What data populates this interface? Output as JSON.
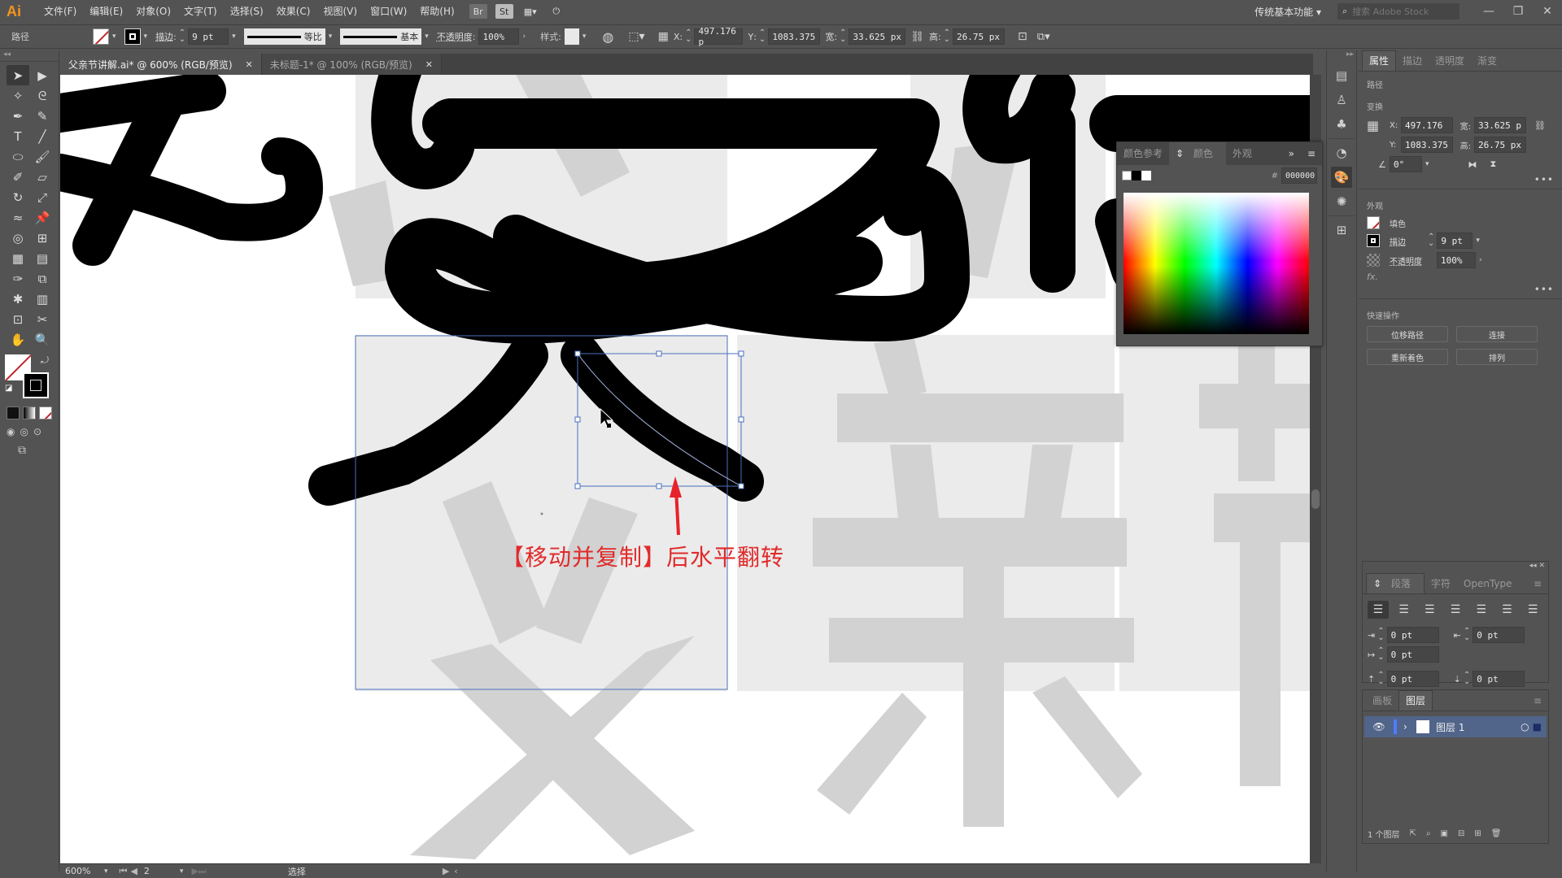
{
  "app": {
    "logo": "Ai",
    "menu": [
      "文件(F)",
      "编辑(E)",
      "对象(O)",
      "文字(T)",
      "选择(S)",
      "效果(C)",
      "视图(V)",
      "窗口(W)",
      "帮助(H)"
    ],
    "menu_icons": [
      "bridge-icon",
      "stock-icon",
      "arrange-documents-icon",
      "gpu-performance-icon"
    ],
    "workspace": "传统基本功能",
    "search_placeholder": "搜索 Adobe Stock",
    "window_controls": {
      "minimize": "—",
      "restore": "❐",
      "close": "✕"
    }
  },
  "control_bar": {
    "object_type": "路径",
    "stroke_label": "描边",
    "stroke_weight": "9 pt",
    "variable_width": "等比",
    "brush": "基本",
    "opacity_label": "不透明度",
    "opacity": "100%",
    "style_label": "样式",
    "x_label": "X",
    "x": "497.176 p",
    "y_label": "Y",
    "y": "1083.375",
    "w_label": "宽",
    "w": "33.625 px",
    "h_label": "高",
    "h": "26.75 px"
  },
  "doc_tabs": [
    {
      "label": "父亲节讲解.ai* @ 600% (RGB/预览)",
      "active": true
    },
    {
      "label": "未标题-1* @ 100% (RGB/预览)",
      "active": false
    }
  ],
  "tools": [
    "selection-tool",
    "direct-selection-tool",
    "magic-wand-tool",
    "lasso-tool",
    "pen-tool",
    "curvature-tool",
    "type-tool",
    "line-tool",
    "ellipse-tool",
    "paintbrush-tool",
    "shaper-tool",
    "eraser-tool",
    "rotate-tool",
    "scale-tool",
    "warp-tool",
    "puppet-warp-tool",
    "shape-builder-tool",
    "perspective-grid-tool",
    "mesh-tool",
    "gradient-tool",
    "eyedropper-tool",
    "blend-tool",
    "symbol-sprayer-tool",
    "column-graph-tool",
    "artboard-tool",
    "slice-tool",
    "hand-tool",
    "zoom-tool"
  ],
  "tool_glyphs": [
    "➤",
    "▶",
    "✧",
    "ᘓ",
    "✒",
    "✎",
    "T",
    "╱",
    "⬭",
    "🖌",
    "✐",
    "▱",
    "↻",
    "⤢",
    "≈",
    "📌",
    "◎",
    "⊞",
    "▦",
    "▤",
    "✑",
    "⧉",
    "✱",
    "▥",
    "⊡",
    "✂",
    "✋",
    "🔍"
  ],
  "canvas": {
    "annotation": "【移动并复制】后水平翻转",
    "ghost_glyph_left": "父",
    "ghost_glyph_mid": "亲",
    "ghost_glyph_right": "节",
    "annotation_color": "#e12a2a"
  },
  "status_bar": {
    "zoom": "600%",
    "artboard": "2",
    "tool": "选择"
  },
  "color_panel": {
    "tabs": [
      "颜色参考",
      "颜色",
      "外观"
    ],
    "active_tab": "颜色",
    "hex": "000000"
  },
  "properties": {
    "tabs": [
      "属性",
      "描边",
      "透明度",
      "渐变"
    ],
    "section_path": "路径",
    "section_transform": "变换",
    "x_label": "X:",
    "x": "497.176",
    "y_label": "Y:",
    "y": "1083.375",
    "w_label": "宽:",
    "w": "33.625 p",
    "h_label": "高:",
    "h": "26.75 px",
    "angle": "0°",
    "section_appearance": "外观",
    "fill_label": "填色",
    "stroke_label": "描边",
    "stroke_weight": "9 pt",
    "opacity_label": "不透明度",
    "opacity": "100%",
    "fx": "fx.",
    "section_quick": "快速操作",
    "quick_actions": [
      "位移路径",
      "连接",
      "重新着色",
      "排列"
    ]
  },
  "paragraph_panel": {
    "tabs": [
      "段落",
      "字符",
      "OpenType"
    ],
    "left_indent": "0 pt",
    "right_indent": "0 pt",
    "first_line_indent": "0 pt",
    "space_before": "0 pt",
    "space_after": "0 pt"
  },
  "layers_panel": {
    "tabs": [
      "画板",
      "图层"
    ],
    "layers": [
      {
        "name": "图层 1"
      }
    ],
    "footer": "1 个图层"
  }
}
